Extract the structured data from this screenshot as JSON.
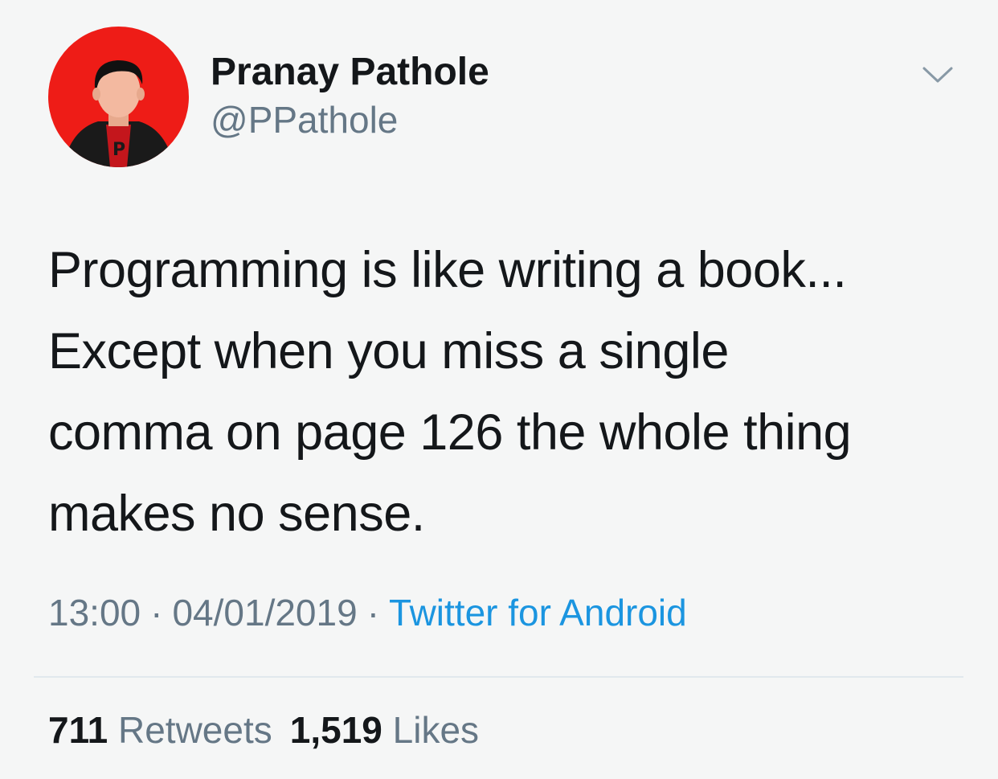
{
  "tweet": {
    "author": {
      "display_name": "Pranay Pathole",
      "handle": "@PPathole",
      "avatar": {
        "icon": "profile-avatar",
        "background_color": "#ee1c17",
        "shirt_letter": "P"
      }
    },
    "menu_icon": "chevron-down-icon",
    "text": "Programming is like writing a book...\nExcept when you miss a single\ncomma on page 126 the whole thing\nmakes no sense.",
    "time": "13:00",
    "date": "04/01/2019",
    "separator": "·",
    "source": "Twitter for Android",
    "retweets": {
      "count": "711",
      "label": "Retweets"
    },
    "likes": {
      "count": "1,519",
      "label": "Likes"
    }
  },
  "colors": {
    "background": "#f5f6f6",
    "text": "#14171a",
    "secondary_text": "#657786",
    "link": "#1b95e0",
    "avatar_red": "#ee1c17"
  }
}
